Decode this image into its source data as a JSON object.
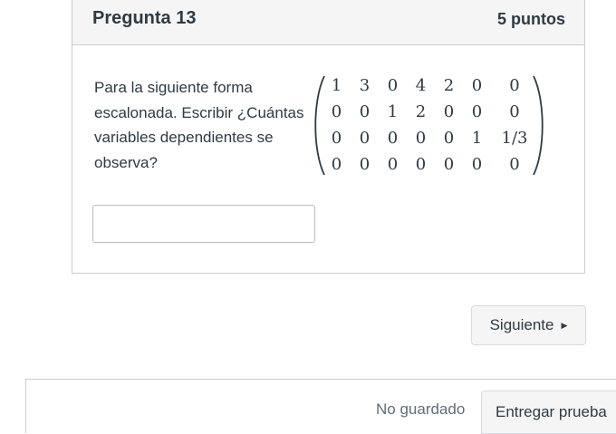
{
  "question": {
    "title": "Pregunta 13",
    "points": "5 puntos",
    "text": "Para la siguiente forma escalonada. Escribir ¿Cuántas variables dependientes se observa?",
    "matrix": [
      [
        "1",
        "3",
        "0",
        "4",
        "2",
        "0",
        "0"
      ],
      [
        "0",
        "0",
        "1",
        "2",
        "0",
        "0",
        "0"
      ],
      [
        "0",
        "0",
        "0",
        "0",
        "0",
        "1",
        "1/3"
      ],
      [
        "0",
        "0",
        "0",
        "0",
        "0",
        "0",
        "0"
      ]
    ],
    "answer_value": ""
  },
  "navigation": {
    "next_label": "Siguiente",
    "next_icon": "play-right-icon"
  },
  "footer": {
    "save_status": "No guardado",
    "submit_label": "Entregar prueba"
  },
  "colors": {
    "text": "#2d3b45",
    "header_bg": "#f5f5f5",
    "border": "#c7cdd1",
    "muted": "#5f6e78"
  }
}
